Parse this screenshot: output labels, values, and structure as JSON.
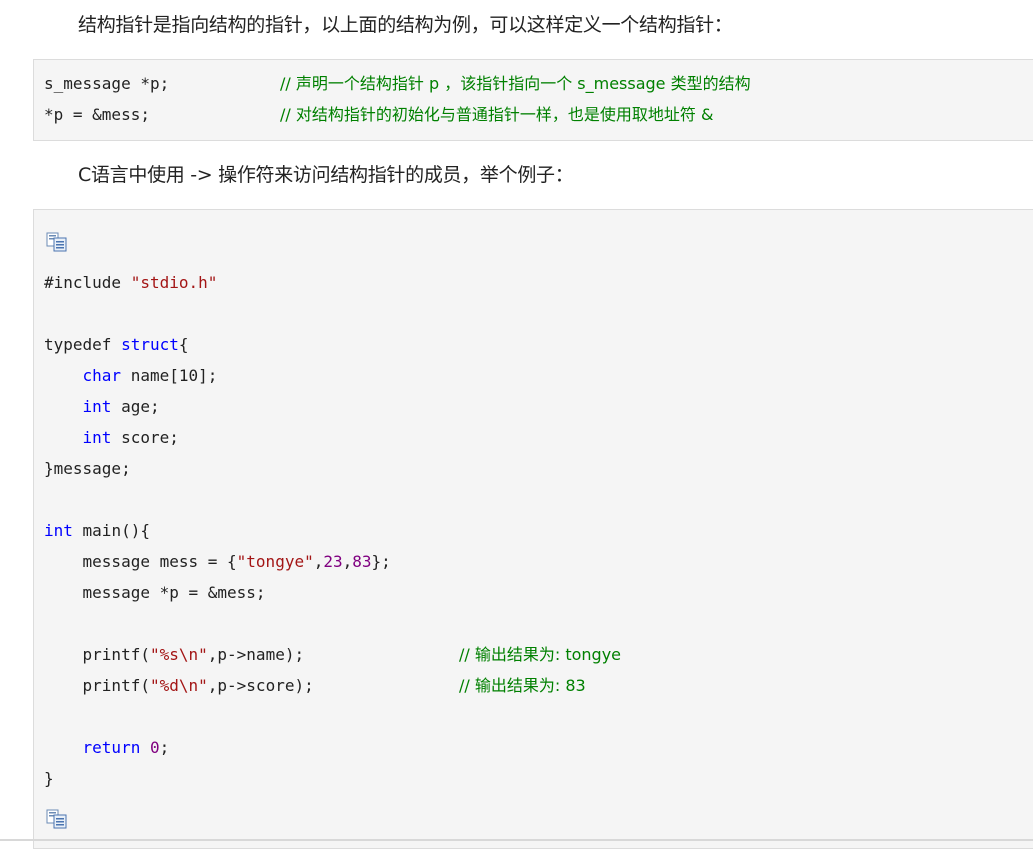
{
  "paragraphs": {
    "p1": "结构指针是指向结构的指针，以上面的结构为例，可以这样定义一个结构指针：",
    "p2": "C语言中使用 -> 操作符来访问结构指针的成员，举个例子："
  },
  "snippet1": {
    "line1": {
      "code": "s_message *p;",
      "comment": "// 声明一个结构指针 p ，该指针指向一个 s_message 类型的结构"
    },
    "line2": {
      "code": "*p = &mess;",
      "comment": "// 对结构指针的初始化与普通指针一样，也是使用取地址符 &"
    }
  },
  "snippet2": {
    "include": {
      "directive": "#include ",
      "file": "\"stdio.h\""
    },
    "typedef_kw": "typedef ",
    "struct_kw": "struct",
    "open_brace": "{",
    "field1": {
      "type": "char",
      "rest": " name[10];"
    },
    "field2": {
      "type": "int",
      "rest": " age;"
    },
    "field3": {
      "type": "int",
      "rest": " score;"
    },
    "close_typedef": "}message;",
    "main_kw": "int",
    "main_rest": " main(){",
    "decl": {
      "a": "message mess = {",
      "s": "\"tongye\"",
      "c1": ",",
      "n1": "23",
      "c2": ",",
      "n2": "83",
      "e": "};"
    },
    "ptr_decl": "message *p = &mess;",
    "printf1": {
      "a": "printf(",
      "s": "\"%s\\n\"",
      "b": ",p->name);",
      "comment": "// 输出结果为: tongye"
    },
    "printf2": {
      "a": "printf(",
      "s": "\"%d\\n\"",
      "b": ",p->score);",
      "comment": "// 输出结果为: 83"
    },
    "ret": {
      "kw": "return",
      "num": "0",
      "end": ";"
    },
    "close_main": "}"
  },
  "icons": {
    "copy": "copy-code-icon"
  },
  "colors": {
    "keyword": "#0000ff",
    "string": "#a31515",
    "number": "#800080",
    "comment": "#008000",
    "code_bg": "#f5f5f5"
  }
}
